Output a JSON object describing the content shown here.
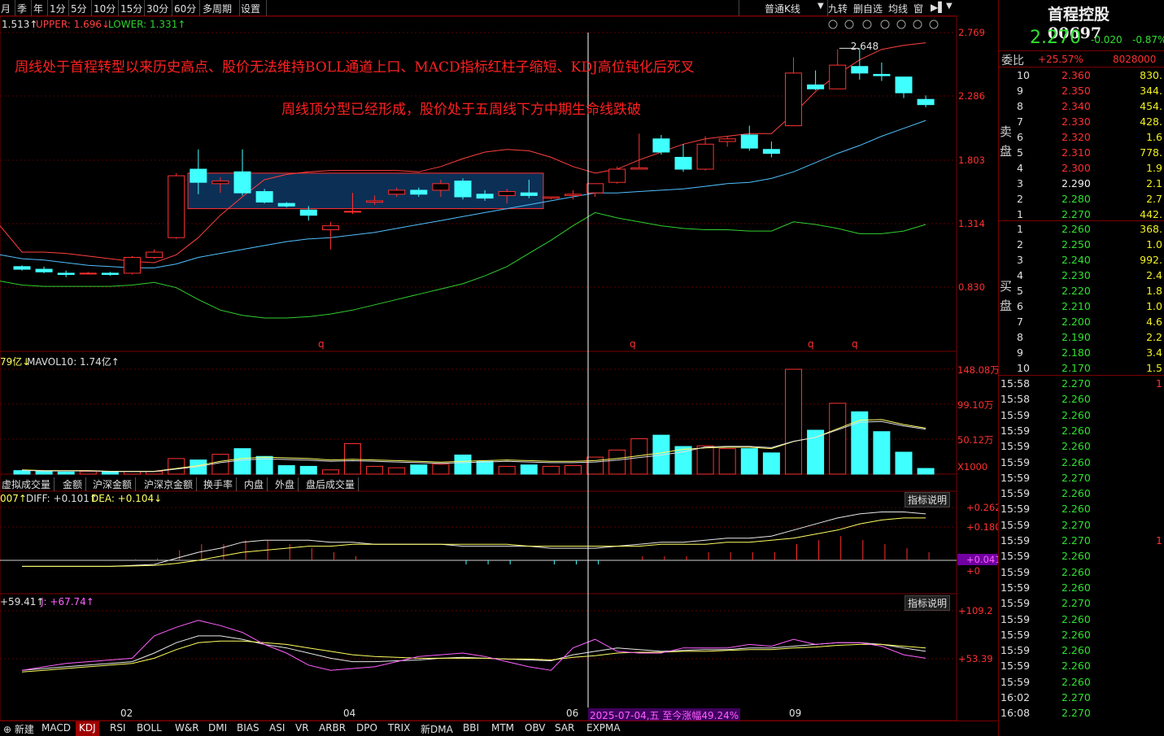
{
  "toolbar": {
    "items": [
      "月",
      "季",
      "年",
      "1分",
      "5分",
      "10分",
      "15分",
      "30分",
      "60分",
      "多周期",
      "设置"
    ],
    "kline_type": "普通K线",
    "right_items": [
      "九转",
      "删自选",
      "均线",
      "窗"
    ]
  },
  "colors": {
    "up": "#ff3030",
    "down": "#40ffff",
    "upper": "#ff4040",
    "mid": "#50c0ff",
    "lower": "#30d030",
    "bg": "#000000",
    "grid": "#7a0000"
  },
  "legend": {
    "boll_mid": "1.513↑",
    "boll_upper": "UPPER: 1.696↓",
    "boll_lower": "LOWER: 1.331↑",
    "vol_prefix": "79亿↓",
    "vol_mavol10": "MAVOL10: 1.74亿↑",
    "macd_prefix": "007↑",
    "macd_diff": "DIFF: +0.101↑",
    "macd_dea": "DEA: +0.104↓",
    "kdj_prefix": "+59.41↑",
    "kdj_j": "J: +67.74↑"
  },
  "annotation": {
    "line1": "周线处于首程转型以来历史高点、股价无法维持BOLL通道上口、MACD指标红柱子缩短、KDJ高位钝化后死叉",
    "line2": "周线顶分型已经形成，股价处于五周线下方中期生命线跌破"
  },
  "price_axis": [
    "2.769",
    "2.286",
    "1.803",
    "1.314",
    "0.830"
  ],
  "vol_axis": [
    "148.08万",
    "99.10万",
    "50.12万",
    "X1000"
  ],
  "macd_axis": [
    "+0.262",
    "+0.180",
    "+0.041",
    "+0"
  ],
  "kdj_axis": [
    "+109.2",
    "+53.39"
  ],
  "max_price_label": "2.648",
  "date_labels": [
    "02",
    "04",
    "06",
    "09"
  ],
  "crosshair_label": "2025-07-04,五 至今涨幅49.24%",
  "q_marks": [
    "q",
    "q",
    "q",
    "q"
  ],
  "indicator_tabs": [
    "虚拟成交量",
    "金额",
    "沪深金额",
    "沪深京金额",
    "换手率",
    "内盘",
    "外盘",
    "盘后成交量"
  ],
  "indicator_button": "指标说明",
  "bottom_tabs": [
    "新建",
    "MACD",
    "KDJ",
    "RSI",
    "BOLL",
    "W&R",
    "DMI",
    "BIAS",
    "ASI",
    "VR",
    "ARBR",
    "DPO",
    "TRIX",
    "新DMA",
    "BBI",
    "MTM",
    "OBV",
    "SAR",
    "EXPMA"
  ],
  "bottom_active": "KDJ",
  "quote": {
    "name": "首程控股",
    "code": "00697",
    "price": "2.270",
    "change": "-0.020",
    "pct": "-0.87%",
    "ratio_label": "委比",
    "ratio": "+25.57%",
    "ratio_diff": "8028000",
    "sell_label": "卖盘",
    "buy_label": "买盘",
    "asks": [
      [
        "10",
        "2.360",
        "830."
      ],
      [
        "9",
        "2.350",
        "344."
      ],
      [
        "8",
        "2.340",
        "454."
      ],
      [
        "7",
        "2.330",
        "428."
      ],
      [
        "6",
        "2.320",
        "1.6"
      ],
      [
        "5",
        "2.310",
        "778."
      ],
      [
        "4",
        "2.300",
        "1.9"
      ],
      [
        "3",
        "2.290",
        "2.1"
      ],
      [
        "2",
        "2.280",
        "2.7"
      ],
      [
        "1",
        "2.270",
        "442."
      ]
    ],
    "bids": [
      [
        "1",
        "2.260",
        "368."
      ],
      [
        "2",
        "2.250",
        "1.0"
      ],
      [
        "3",
        "2.240",
        "992."
      ],
      [
        "4",
        "2.230",
        "2.4"
      ],
      [
        "5",
        "2.220",
        "1.8"
      ],
      [
        "6",
        "2.210",
        "1.0"
      ],
      [
        "7",
        "2.200",
        "4.6"
      ],
      [
        "8",
        "2.190",
        "2.2"
      ],
      [
        "9",
        "2.180",
        "3.4"
      ],
      [
        "10",
        "2.170",
        "1.5"
      ]
    ],
    "ticks": [
      [
        "15:58",
        "2.270",
        "1"
      ],
      [
        "15:58",
        "2.260",
        ""
      ],
      [
        "15:59",
        "2.260",
        ""
      ],
      [
        "15:59",
        "2.260",
        ""
      ],
      [
        "15:59",
        "2.260",
        ""
      ],
      [
        "15:59",
        "2.260",
        ""
      ],
      [
        "15:59",
        "2.270",
        ""
      ],
      [
        "15:59",
        "2.260",
        ""
      ],
      [
        "15:59",
        "2.260",
        ""
      ],
      [
        "15:59",
        "2.270",
        ""
      ],
      [
        "15:59",
        "2.270",
        "1"
      ],
      [
        "15:59",
        "2.260",
        ""
      ],
      [
        "15:59",
        "2.260",
        ""
      ],
      [
        "15:59",
        "2.260",
        ""
      ],
      [
        "15:59",
        "2.270",
        ""
      ],
      [
        "15:59",
        "2.260",
        ""
      ],
      [
        "15:59",
        "2.260",
        ""
      ],
      [
        "15:59",
        "2.260",
        ""
      ],
      [
        "15:59",
        "2.260",
        ""
      ],
      [
        "15:59",
        "2.260",
        ""
      ],
      [
        "16:02",
        "2.270",
        ""
      ],
      [
        "16:08",
        "2.270",
        ""
      ]
    ]
  },
  "chart_data": {
    "type": "candlestick",
    "title": "",
    "price_range": [
      0.55,
      2.85
    ],
    "candles": [
      [
        0.99,
        0.97,
        1.0,
        0.96
      ],
      [
        0.97,
        0.95,
        0.99,
        0.94
      ],
      [
        0.94,
        0.93,
        0.96,
        0.91
      ],
      [
        0.94,
        0.94,
        0.95,
        0.93
      ],
      [
        0.94,
        0.93,
        0.95,
        0.92
      ],
      [
        0.94,
        1.06,
        1.07,
        0.93
      ],
      [
        1.06,
        1.1,
        1.12,
        1.05
      ],
      [
        1.21,
        1.68,
        1.7,
        1.2
      ],
      [
        1.73,
        1.63,
        1.88,
        1.54
      ],
      [
        1.62,
        1.64,
        1.67,
        1.55
      ],
      [
        1.71,
        1.55,
        1.88,
        1.53
      ],
      [
        1.56,
        1.48,
        1.58,
        1.47
      ],
      [
        1.47,
        1.45,
        1.48,
        1.44
      ],
      [
        1.42,
        1.38,
        1.45,
        1.34
      ],
      [
        1.27,
        1.3,
        1.33,
        1.12
      ],
      [
        1.41,
        1.41,
        1.55,
        1.39
      ],
      [
        1.48,
        1.49,
        1.53,
        1.46
      ],
      [
        1.54,
        1.57,
        1.59,
        1.52
      ],
      [
        1.57,
        1.54,
        1.59,
        1.52
      ],
      [
        1.57,
        1.62,
        1.65,
        1.52
      ],
      [
        1.64,
        1.52,
        1.66,
        1.5
      ],
      [
        1.54,
        1.51,
        1.57,
        1.49
      ],
      [
        1.53,
        1.56,
        1.58,
        1.47
      ],
      [
        1.55,
        1.53,
        1.65,
        1.51
      ],
      [
        1.51,
        1.52,
        1.52,
        1.5
      ],
      [
        1.53,
        1.54,
        1.57,
        1.5
      ],
      [
        1.55,
        1.62,
        1.62,
        1.52
      ],
      [
        1.63,
        1.73,
        1.75,
        1.62
      ],
      [
        1.73,
        1.74,
        2.0,
        1.73
      ],
      [
        1.96,
        1.86,
        1.99,
        1.84
      ],
      [
        1.82,
        1.73,
        1.92,
        1.71
      ],
      [
        1.73,
        1.92,
        1.98,
        1.72
      ],
      [
        1.94,
        1.96,
        1.98,
        1.9
      ],
      [
        1.99,
        1.89,
        2.06,
        1.87
      ],
      [
        1.88,
        1.85,
        1.94,
        1.82
      ],
      [
        2.06,
        2.46,
        2.58,
        2.06
      ],
      [
        2.37,
        2.34,
        2.48,
        2.33
      ],
      [
        2.34,
        2.52,
        2.64,
        2.38
      ],
      [
        2.51,
        2.46,
        2.65,
        2.41
      ],
      [
        2.45,
        2.44,
        2.54,
        2.4
      ],
      [
        2.43,
        2.31,
        2.43,
        2.27
      ],
      [
        2.26,
        2.22,
        2.29,
        2.2
      ]
    ],
    "boll_upper": [
      1.1,
      1.1,
      1.09,
      1.07,
      1.05,
      1.03,
      1.02,
      1.08,
      1.21,
      1.38,
      1.52,
      1.65,
      1.69,
      1.71,
      1.72,
      1.72,
      1.72,
      1.72,
      1.71,
      1.75,
      1.81,
      1.86,
      1.88,
      1.87,
      1.82,
      1.75,
      1.7,
      1.73,
      1.8,
      1.86,
      1.92,
      1.96,
      1.98,
      2.0,
      2.0,
      2.15,
      2.32,
      2.45,
      2.56,
      2.64,
      2.67,
      2.69
    ],
    "boll_mid": [
      1.05,
      1.04,
      1.02,
      1.0,
      0.99,
      0.98,
      0.98,
      1.01,
      1.06,
      1.09,
      1.12,
      1.15,
      1.18,
      1.2,
      1.21,
      1.23,
      1.25,
      1.28,
      1.31,
      1.34,
      1.37,
      1.4,
      1.43,
      1.46,
      1.49,
      1.52,
      1.55,
      1.55,
      1.56,
      1.57,
      1.58,
      1.6,
      1.62,
      1.63,
      1.66,
      1.71,
      1.78,
      1.85,
      1.91,
      1.98,
      2.04,
      2.1
    ],
    "boll_lower": [
      0.85,
      0.84,
      0.84,
      0.84,
      0.84,
      0.85,
      0.87,
      0.83,
      0.74,
      0.66,
      0.62,
      0.6,
      0.6,
      0.61,
      0.63,
      0.66,
      0.7,
      0.74,
      0.78,
      0.82,
      0.86,
      0.92,
      0.99,
      1.09,
      1.19,
      1.3,
      1.4,
      1.36,
      1.33,
      1.3,
      1.28,
      1.27,
      1.27,
      1.26,
      1.26,
      1.33,
      1.31,
      1.28,
      1.24,
      1.24,
      1.26,
      1.31
    ],
    "volume_wan": [
      5,
      4,
      3,
      4,
      3,
      4,
      4,
      22,
      20,
      28,
      36,
      25,
      12,
      11,
      6,
      43,
      11,
      9,
      13,
      14,
      27,
      18,
      11,
      13,
      11,
      12,
      24,
      34,
      50,
      55,
      39,
      40,
      36,
      36,
      30,
      148,
      62,
      100,
      88,
      60,
      31,
      8
    ],
    "vol_ma_wan": [
      6,
      5,
      5,
      5,
      4,
      4,
      4,
      8,
      12,
      18,
      22,
      24,
      23,
      22,
      20,
      21,
      20,
      19,
      18,
      17,
      18,
      19,
      20,
      19,
      18,
      18,
      19,
      22,
      26,
      30,
      35,
      37,
      38,
      38,
      36,
      46,
      52,
      64,
      76,
      77,
      70,
      65
    ],
    "macd_diff": [
      -0.03,
      -0.03,
      -0.03,
      -0.03,
      -0.03,
      -0.025,
      -0.02,
      0.01,
      0.04,
      0.06,
      0.09,
      0.1,
      0.1,
      0.1,
      0.09,
      0.09,
      0.08,
      0.08,
      0.08,
      0.08,
      0.07,
      0.07,
      0.07,
      0.07,
      0.06,
      0.06,
      0.06,
      0.07,
      0.08,
      0.09,
      0.09,
      0.1,
      0.11,
      0.11,
      0.12,
      0.15,
      0.18,
      0.21,
      0.23,
      0.24,
      0.24,
      0.23
    ],
    "macd_dea": [
      -0.03,
      -0.03,
      -0.03,
      -0.03,
      -0.03,
      -0.028,
      -0.025,
      -0.015,
      0.0,
      0.02,
      0.04,
      0.05,
      0.06,
      0.07,
      0.07,
      0.08,
      0.08,
      0.08,
      0.08,
      0.08,
      0.08,
      0.08,
      0.08,
      0.07,
      0.07,
      0.07,
      0.07,
      0.07,
      0.07,
      0.08,
      0.08,
      0.08,
      0.09,
      0.09,
      0.1,
      0.11,
      0.13,
      0.15,
      0.18,
      0.2,
      0.21,
      0.21
    ],
    "kdj_k": [
      40,
      42,
      44,
      46,
      48,
      50,
      60,
      72,
      80,
      80,
      76,
      70,
      66,
      60,
      54,
      50,
      50,
      51,
      52,
      54,
      55,
      54,
      53,
      52,
      51,
      58,
      62,
      66,
      64,
      62,
      63,
      64,
      64,
      66,
      66,
      68,
      70,
      72,
      72,
      70,
      66,
      62
    ],
    "kdj_d": [
      38,
      40,
      42,
      44,
      46,
      48,
      54,
      64,
      72,
      74,
      74,
      72,
      70,
      66,
      62,
      58,
      56,
      55,
      54,
      54,
      54,
      54,
      53,
      53,
      52,
      55,
      57,
      60,
      61,
      61,
      62,
      62,
      63,
      64,
      64,
      66,
      67,
      69,
      70,
      70,
      68,
      66
    ],
    "kdj_j": [
      40,
      44,
      48,
      50,
      52,
      54,
      80,
      90,
      98,
      92,
      84,
      70,
      60,
      46,
      40,
      42,
      44,
      50,
      56,
      58,
      60,
      56,
      50,
      44,
      40,
      66,
      76,
      62,
      60,
      60,
      66,
      66,
      66,
      70,
      68,
      76,
      70,
      72,
      72,
      68,
      58,
      54
    ]
  }
}
